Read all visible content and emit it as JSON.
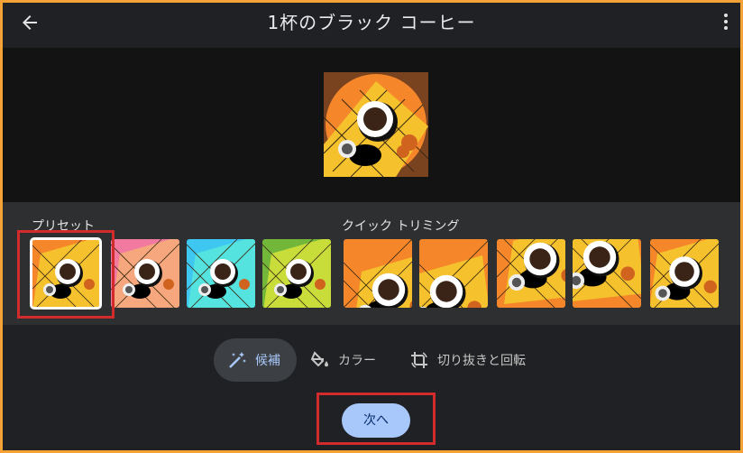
{
  "header": {
    "title": "1杯のブラック コーヒー",
    "back_icon": "arrow-left-icon",
    "more_icon": "more-vert-icon"
  },
  "sections": {
    "presets_label": "プリセット",
    "quick_trim_label": "クイック トリミング"
  },
  "presets": [
    {
      "name": "preset-original",
      "bg": "#f5872a",
      "tile": "#f5c12c",
      "selected": true
    },
    {
      "name": "preset-pink",
      "bg": "#f27aa0",
      "tile": "#f6a77e",
      "selected": false
    },
    {
      "name": "preset-cyan",
      "bg": "#3ec7f0",
      "tile": "#55e3e0",
      "selected": false
    },
    {
      "name": "preset-green",
      "bg": "#72b63a",
      "tile": "#c8dc3a",
      "selected": false
    }
  ],
  "trims": [
    {
      "name": "trim-1"
    },
    {
      "name": "trim-2"
    },
    {
      "name": "trim-3"
    },
    {
      "name": "trim-4"
    },
    {
      "name": "trim-5"
    }
  ],
  "tabs": [
    {
      "label": "候補",
      "icon": "magic-wand-icon",
      "active": true
    },
    {
      "label": "カラー",
      "icon": "paint-bucket-icon",
      "active": false
    },
    {
      "label": "切り抜きと回転",
      "icon": "crop-rotate-icon",
      "active": false
    }
  ],
  "next_button": {
    "label": "次へ"
  },
  "colors": {
    "accent": "#a8c7fa",
    "highlight_box": "#d22b2b",
    "frame": "#f4a235"
  }
}
